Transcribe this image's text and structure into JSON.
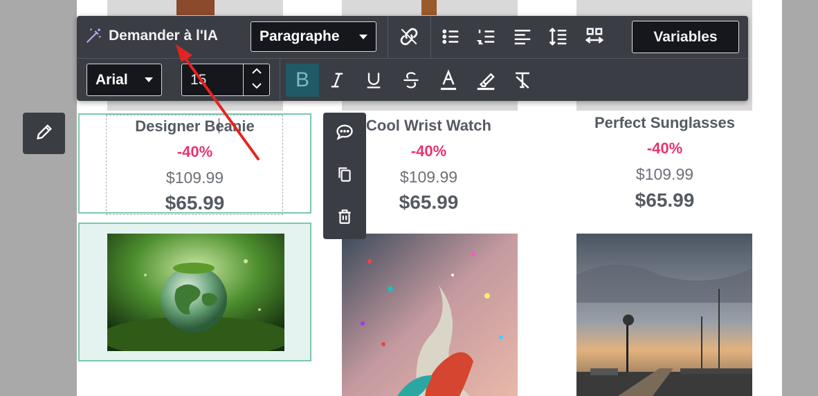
{
  "toolbar": {
    "ai_button_label": "Demander à l'IA",
    "paragraph_select_value": "Paragraphe",
    "variables_button_label": "Variables",
    "font_select_value": "Arial",
    "font_size_value": "15"
  },
  "products": [
    {
      "name": "Designer Beanie",
      "discount": "-40%",
      "old_price": "$109.99",
      "price": "$65.99"
    },
    {
      "name": "Cool Wrist Watch",
      "discount": "-40%",
      "old_price": "$109.99",
      "price": "$65.99"
    },
    {
      "name": "Perfect Sunglasses",
      "discount": "-40%",
      "old_price": "$109.99",
      "price": "$65.99"
    }
  ],
  "images": [
    {
      "icon": "globe-in-moss-image"
    },
    {
      "icon": "paint-splash-image"
    },
    {
      "icon": "harbor-sunset-image"
    }
  ],
  "colors": {
    "toolbar_bg": "#3b3d45",
    "discount": "#e8336d",
    "selection": "#7cc6ae",
    "active_bold": "#1f5a66",
    "annotation_arrow": "#e8231f"
  }
}
